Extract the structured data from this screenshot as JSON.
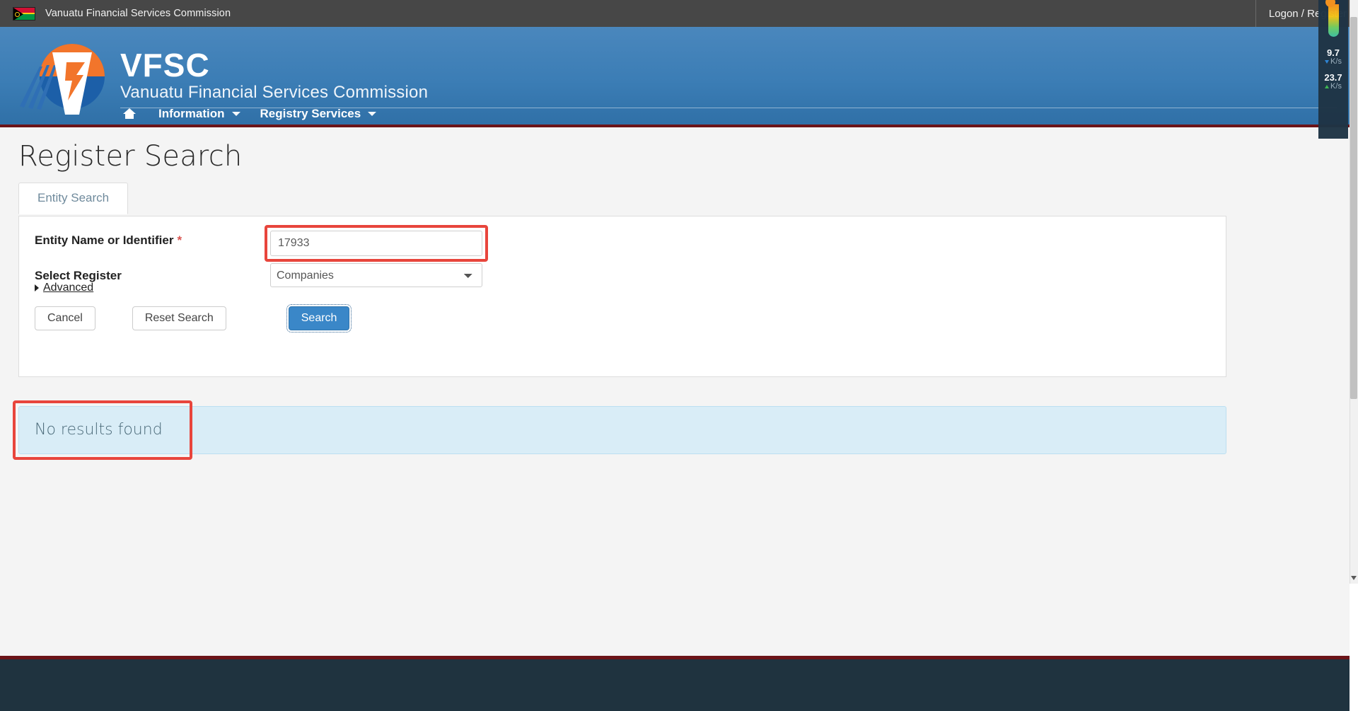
{
  "topbar": {
    "flag_icon": "vanuatu-flag-icon",
    "site_name": "Vanuatu Financial Services Commission",
    "logon_label": "Logon / Register"
  },
  "header": {
    "logo_icon": "vfsc-logo-icon",
    "brand_acronym": "VFSC",
    "brand_name": "Vanuatu Financial Services Commission",
    "nav": [
      {
        "label": "",
        "icon": "home-icon",
        "has_caret": false
      },
      {
        "label": "Information",
        "icon": "",
        "has_caret": true
      },
      {
        "label": "Registry Services",
        "icon": "",
        "has_caret": true
      }
    ]
  },
  "main": {
    "page_title": "Register Search",
    "tabs": [
      {
        "label": "Entity Search",
        "active": true
      }
    ],
    "form": {
      "entity_field": {
        "label": "Entity Name or Identifier",
        "required_marker": "*",
        "value": "17933",
        "placeholder": ""
      },
      "register_field": {
        "label": "Select Register",
        "value": "Companies",
        "options": [
          "Companies"
        ]
      },
      "advanced_label": "Advanced",
      "buttons": {
        "cancel": "Cancel",
        "reset": "Reset Search",
        "search": "Search"
      }
    },
    "results": {
      "message": "No results found"
    }
  },
  "overlay": {
    "download": {
      "value": "9.7",
      "unit": "K/s",
      "direction": "down"
    },
    "upload": {
      "value": "23.7",
      "unit": "K/s",
      "direction": "up"
    }
  },
  "colors": {
    "header_blue": "#3b7db5",
    "accent_orange": "#f2752b",
    "accent_red": "#e8453c",
    "dark_red_rule": "#6b1418",
    "primary_button": "#3a87c8",
    "info_bg": "#d9edf7",
    "footer_dark": "#1f333f"
  }
}
